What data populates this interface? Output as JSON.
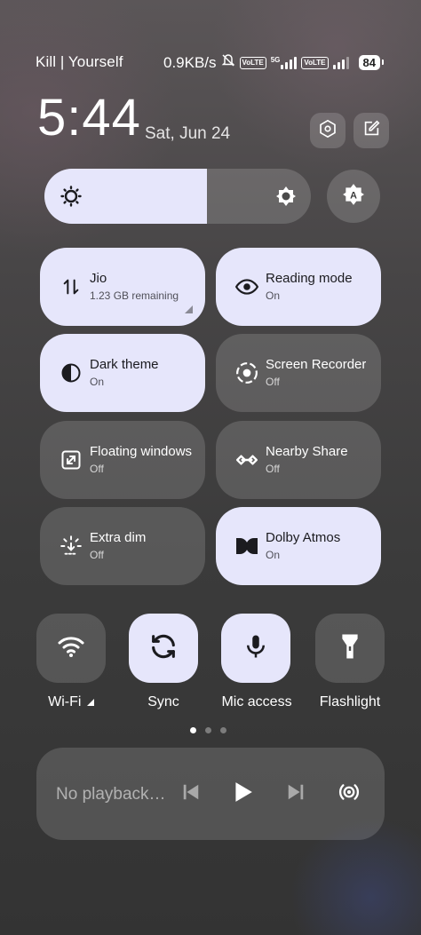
{
  "status_bar": {
    "left_text": "Kill | Yourself",
    "network_speed": "0.9KB/s",
    "volte1": "VoLTE",
    "network_type": "5G",
    "volte2": "VoLTE",
    "battery": "84"
  },
  "header": {
    "time": "5:44",
    "date": "Sat, Jun 24",
    "settings_icon": "hexagon-settings-icon",
    "edit_icon": "edit-icon"
  },
  "brightness": {
    "level": 0.61,
    "low_icon": "sun-icon",
    "high_icon": "sun-icon",
    "auto_icon": "auto-brightness-icon"
  },
  "tiles": [
    {
      "name": "Jio",
      "state": "1.23 GB remaining",
      "on": true,
      "icon": "data-transfer-icon"
    },
    {
      "name": "Reading mode",
      "state": "On",
      "on": true,
      "icon": "eye-icon"
    },
    {
      "name": "Dark theme",
      "state": "On",
      "on": true,
      "icon": "half-circle-icon"
    },
    {
      "name": "Screen Recorder",
      "state": "Off",
      "on": false,
      "icon": "record-icon"
    },
    {
      "name": "Floating windows",
      "state": "Off",
      "on": false,
      "icon": "floating-window-icon"
    },
    {
      "name": "Nearby Share",
      "state": "Off",
      "on": false,
      "icon": "nearby-share-icon"
    },
    {
      "name": "Extra dim",
      "state": "Off",
      "on": false,
      "icon": "extra-dim-icon"
    },
    {
      "name": "Dolby Atmos",
      "state": "On",
      "on": true,
      "icon": "dolby-icon"
    }
  ],
  "toggles": [
    {
      "label": "Wi-Fi",
      "on": false,
      "icon": "wifi-icon"
    },
    {
      "label": "Sync",
      "on": true,
      "icon": "sync-icon"
    },
    {
      "label": "Mic access",
      "on": true,
      "icon": "mic-icon"
    },
    {
      "label": "Flashlight",
      "on": false,
      "icon": "flashlight-icon"
    }
  ],
  "pager": {
    "pages": 3,
    "current": 1
  },
  "media": {
    "text": "No playback…",
    "prev_icon": "skip-previous-icon",
    "play_icon": "play-icon",
    "next_icon": "skip-next-icon",
    "output_icon": "audio-output-icon"
  },
  "colors": {
    "tile_on": "#e6e6fb",
    "tile_off": "rgba(255,255,255,0.15)"
  }
}
